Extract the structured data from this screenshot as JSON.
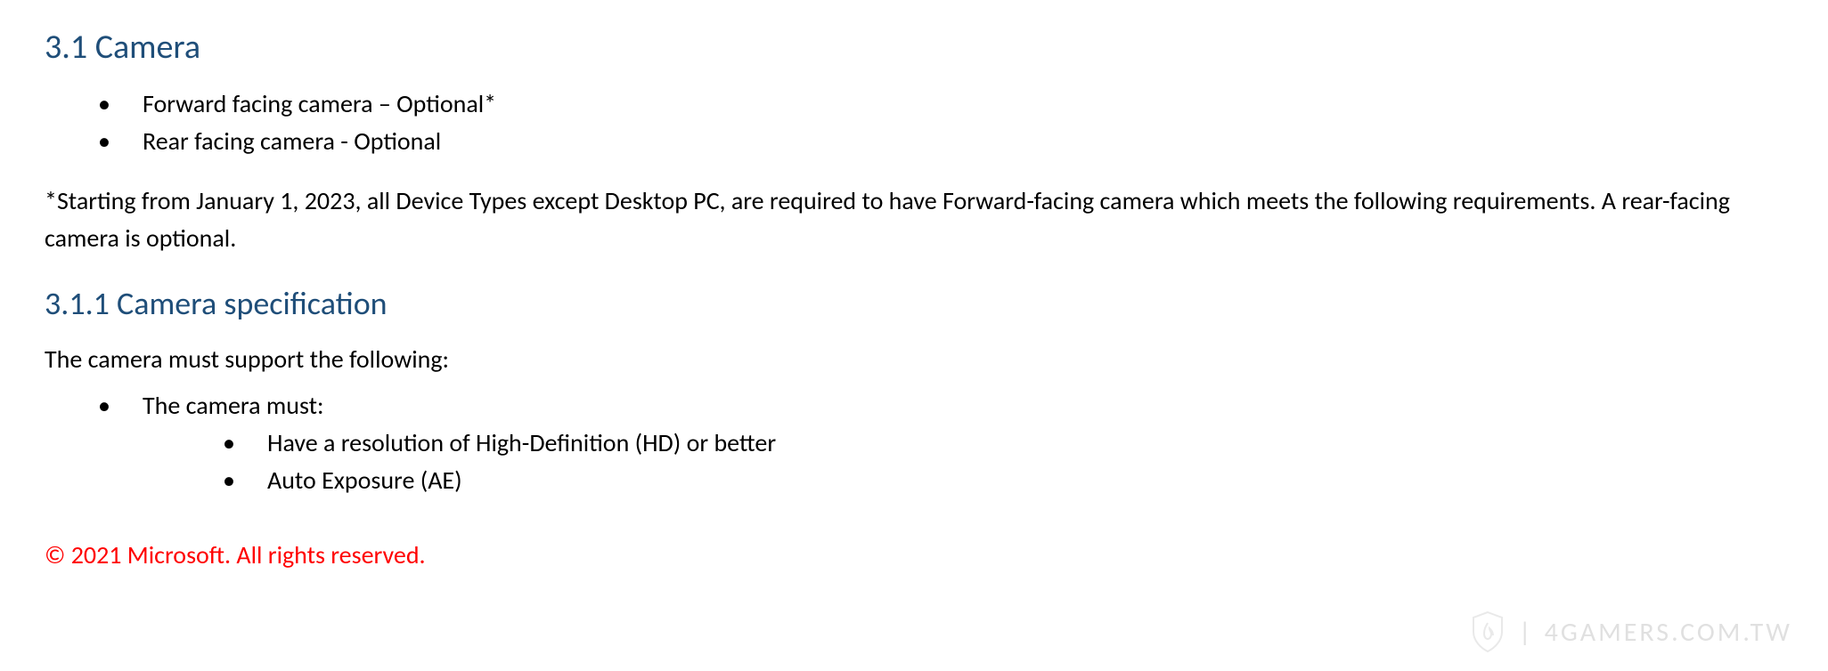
{
  "section1": {
    "heading": "3.1 Camera",
    "bullets": [
      "Forward facing camera – Optional*",
      "Rear facing camera - Optional"
    ],
    "note": "*Starting from January 1, 2023, all Device Types except Desktop PC, are required to have Forward-facing camera which meets the following requirements. A rear-facing camera is optional."
  },
  "section2": {
    "heading": "3.1.1 Camera specification",
    "intro": "The camera must support the following:",
    "bullets": [
      {
        "text": "The camera must:",
        "children": [
          "Have a resolution of High-Definition (HD) or better",
          "Auto Exposure (AE)"
        ]
      }
    ]
  },
  "copyright": "© 2021 Microsoft. All rights reserved.",
  "watermark": {
    "text": "4GAMERS.COM.TW"
  }
}
